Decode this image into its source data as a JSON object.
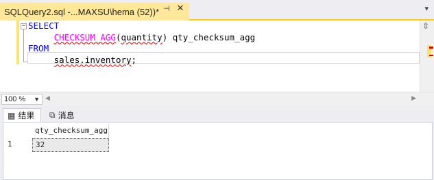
{
  "tab": {
    "title": "SQLQuery2.sql -...MAXSU\\hema (52))*",
    "pin_glyph": "⊣",
    "close_glyph": "✕",
    "overflow_glyph": "▾"
  },
  "editor": {
    "fold_glyph": "−",
    "lines": [
      {
        "kw": "SELECT"
      },
      {
        "indent": "     ",
        "fn": "CHECKSUM_AGG",
        "open": "(",
        "arg": "quantity",
        "close": ")",
        "rest": " qty_checksum_agg"
      },
      {
        "kw": "FROM"
      },
      {
        "indent": "     ",
        "obj": "sales.inventory",
        "semi": ";"
      }
    ]
  },
  "zoom": {
    "value": "100 %"
  },
  "results": {
    "tabs": [
      {
        "label": "结果",
        "icon": "grid-icon"
      },
      {
        "label": "消息",
        "icon": "messages-icon"
      }
    ],
    "columns": [
      "qty_checksum_agg"
    ],
    "rows": [
      {
        "num": "1",
        "cells": [
          "32"
        ]
      }
    ]
  },
  "colors": {
    "keyword": "#0000ff",
    "function": "#ff00ff",
    "tab_active": "#ffe89a",
    "accent": "#ffcc00"
  }
}
